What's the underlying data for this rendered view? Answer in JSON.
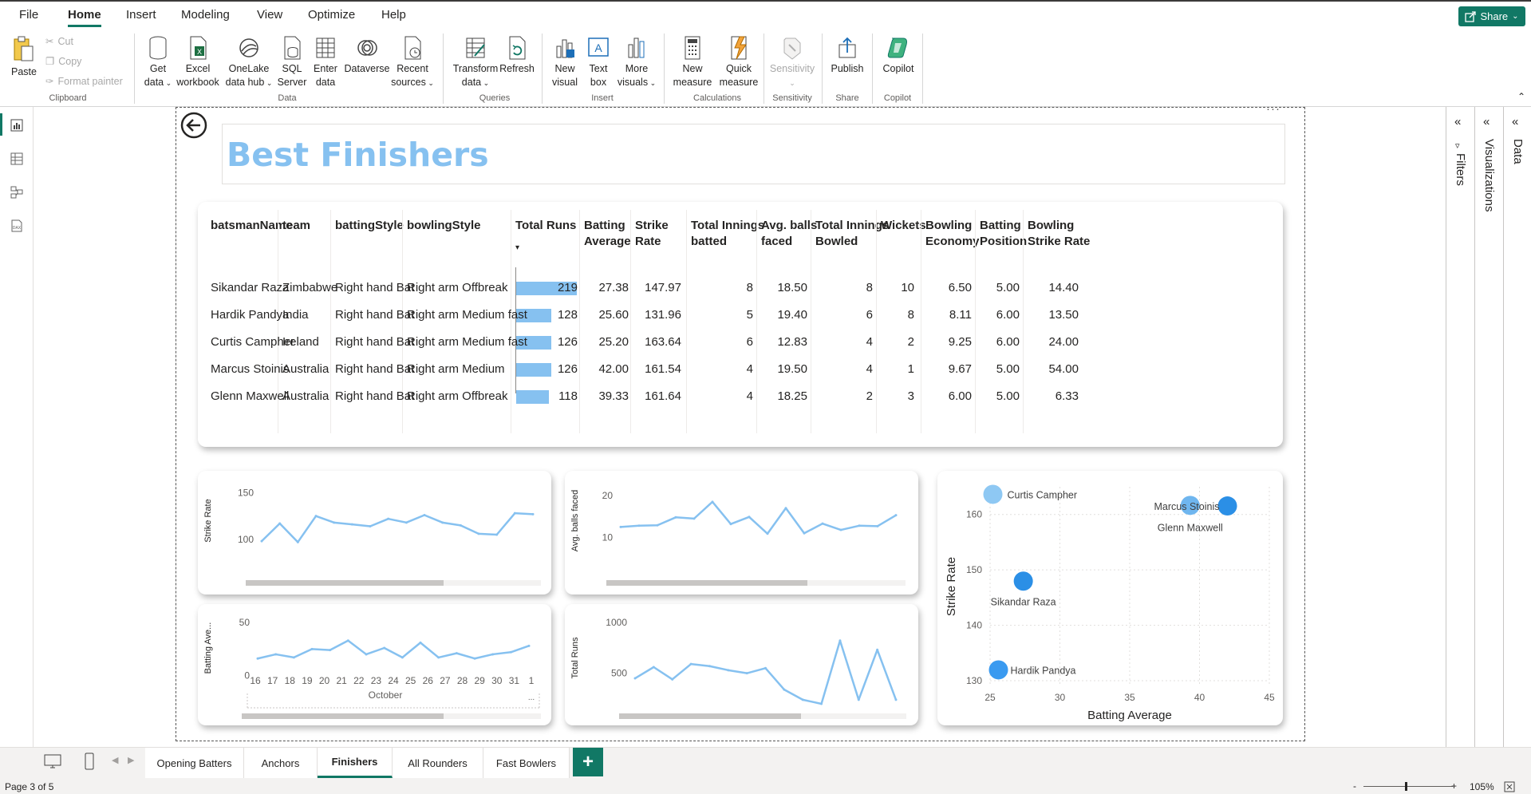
{
  "menu": {
    "items": [
      "File",
      "Home",
      "Insert",
      "Modeling",
      "View",
      "Optimize",
      "Help"
    ],
    "share": "Share"
  },
  "ribbon": {
    "clipboard": {
      "paste": "Paste",
      "cut": "Cut",
      "copy": "Copy",
      "format_painter": "Format painter",
      "group": "Clipboard"
    },
    "data": {
      "get_data": [
        "Get",
        "data"
      ],
      "excel": [
        "Excel",
        "workbook"
      ],
      "onelake": [
        "OneLake",
        "data hub"
      ],
      "sql": [
        "SQL",
        "Server"
      ],
      "enter": [
        "Enter",
        "data"
      ],
      "dataverse": "Dataverse",
      "recent": [
        "Recent",
        "sources"
      ],
      "group": "Data"
    },
    "queries": {
      "transform": [
        "Transform",
        "data"
      ],
      "refresh": "Refresh",
      "group": "Queries"
    },
    "insert": {
      "new_visual": [
        "New",
        "visual"
      ],
      "text_box": [
        "Text",
        "box"
      ],
      "more_visuals": [
        "More",
        "visuals"
      ],
      "group": "Insert"
    },
    "calculations": {
      "new_measure": [
        "New",
        "measure"
      ],
      "quick_measure": [
        "Quick",
        "measure"
      ],
      "group": "Calculations"
    },
    "sensitivity": {
      "label": "Sensitivity",
      "group": "Sensitivity"
    },
    "share": {
      "publish": "Publish",
      "group": "Share"
    },
    "copilot": {
      "label": "Copilot",
      "group": "Copilot"
    }
  },
  "report": {
    "title": "Best Finishers",
    "more_options": "···"
  },
  "table": {
    "headers": [
      [
        "batsmanName"
      ],
      [
        "team"
      ],
      [
        "battingStyle"
      ],
      [
        "bowlingStyle"
      ],
      [
        "Total Runs"
      ],
      [
        "Batting",
        "Average"
      ],
      [
        "Strike",
        "Rate"
      ],
      [
        "Total Innings",
        "batted"
      ],
      [
        "Avg. balls",
        "faced"
      ],
      [
        "Total Innings",
        "Bowled"
      ],
      [
        "Wickets"
      ],
      [
        "Bowling",
        "Economy"
      ],
      [
        "Batting",
        "Position"
      ],
      [
        "Bowling",
        "Strike Rate"
      ]
    ],
    "rows": [
      [
        "Sikandar Raza",
        "Zimbabwe",
        "Right hand Bat",
        "Right arm Offbreak",
        "219",
        "27.38",
        "147.97",
        "8",
        "18.50",
        "8",
        "10",
        "6.50",
        "5.00",
        "14.40"
      ],
      [
        "Hardik Pandya",
        "India",
        "Right hand Bat",
        "Right arm Medium fast",
        "128",
        "25.60",
        "131.96",
        "5",
        "19.40",
        "6",
        "8",
        "8.11",
        "6.00",
        "13.50"
      ],
      [
        "Curtis Campher",
        "Ireland",
        "Right hand Bat",
        "Right arm Medium fast",
        "126",
        "25.20",
        "163.64",
        "6",
        "12.83",
        "4",
        "2",
        "9.25",
        "6.00",
        "24.00"
      ],
      [
        "Marcus Stoinis",
        "Australia",
        "Right hand Bat",
        "Right arm Medium",
        "126",
        "42.00",
        "161.54",
        "4",
        "19.50",
        "4",
        "1",
        "9.67",
        "5.00",
        "54.00"
      ],
      [
        "Glenn Maxwell",
        "Australia",
        "Right hand Bat",
        "Right arm Offbreak",
        "118",
        "39.33",
        "161.64",
        "4",
        "18.25",
        "2",
        "3",
        "6.00",
        "5.00",
        "6.33"
      ]
    ],
    "bar_values": [
      219,
      128,
      126,
      126,
      118
    ],
    "bar_max": 219,
    "bar_color": "#86c1f0"
  },
  "chart_data": [
    {
      "type": "line",
      "ylabel": "Strike Rate",
      "yticks": [
        "150",
        "100"
      ],
      "ylim": [
        75,
        165
      ],
      "values": [
        98,
        117,
        97,
        125,
        118,
        116,
        114,
        122,
        118,
        126,
        118,
        115,
        106,
        105,
        128,
        127
      ],
      "color": "#86c1f0"
    },
    {
      "type": "line",
      "ylabel": "Avg. balls faced",
      "yticks": [
        "20",
        "10"
      ],
      "ylim": [
        4,
        24
      ],
      "values": [
        12.5,
        12.8,
        12.9,
        14.8,
        14.5,
        18.5,
        13.2,
        14.9,
        10.9,
        17.0,
        11.0,
        13.3,
        11.8,
        12.8,
        12.7,
        15.3
      ],
      "color": "#86c1f0"
    },
    {
      "type": "line",
      "ylabel": "Batting Ave...",
      "yticks": [
        "50",
        "0"
      ],
      "ylim": [
        -8,
        60
      ],
      "values": [
        16,
        20,
        17,
        25,
        24,
        33,
        20,
        26,
        17,
        31,
        17,
        21,
        16,
        20,
        22,
        28
      ],
      "x_ticks": [
        "16",
        "17",
        "18",
        "19",
        "20",
        "21",
        "22",
        "23",
        "24",
        "25",
        "26",
        "27",
        "28",
        "29",
        "30",
        "31",
        "1"
      ],
      "x_group": "October",
      "x_more": "...",
      "color": "#86c1f0"
    },
    {
      "type": "line",
      "ylabel": "Total Runs",
      "yticks": [
        "1000",
        "500"
      ],
      "ylim": [
        200,
        1100
      ],
      "values": [
        450,
        560,
        440,
        590,
        570,
        530,
        500,
        550,
        340,
        240,
        200,
        820,
        240,
        730,
        240
      ],
      "color": "#86c1f0"
    },
    {
      "type": "scatter",
      "xlabel": "Batting Average",
      "ylabel": "Strike Rate",
      "xticks": [
        "25",
        "30",
        "35",
        "40",
        "45"
      ],
      "yticks": [
        "160",
        "150",
        "140",
        "130"
      ],
      "xlim": [
        25,
        45
      ],
      "ylim": [
        129,
        165
      ],
      "points": [
        {
          "label": "Curtis Campher",
          "x": 25.2,
          "y": 163.64
        },
        {
          "label": "Marcus Stoinis",
          "x": 42.0,
          "y": 161.54
        },
        {
          "label": "Glenn Maxwell",
          "x": 39.33,
          "y": 161.64
        },
        {
          "label": "Sikandar Raza",
          "x": 27.38,
          "y": 147.97
        },
        {
          "label": "Hardik Pandya",
          "x": 25.6,
          "y": 131.96
        }
      ],
      "colors": {
        "Curtis Campher": "#8ec8f3",
        "Marcus Stoinis": "#2b8fe6",
        "Glenn Maxwell": "#6fb6ef",
        "Sikandar Raza": "#2b8fe6",
        "Hardik Pandya": "#3a9af0"
      }
    }
  ],
  "panes": {
    "filters": "Filters",
    "visualizations": "Visualizations",
    "data": "Data"
  },
  "tabs": {
    "items": [
      "Opening Batters",
      "Anchors",
      "Finishers",
      "All Rounders",
      "Fast Bowlers"
    ],
    "active": "Finishers",
    "add": "+"
  },
  "status": {
    "page": "Page 3 of 5",
    "zoom": "105%",
    "zoom_minus": "-",
    "zoom_plus": "+"
  },
  "colors": {
    "accent": "#117865",
    "title": "#86c1f0",
    "scrollbar": "#c8c6c4"
  }
}
